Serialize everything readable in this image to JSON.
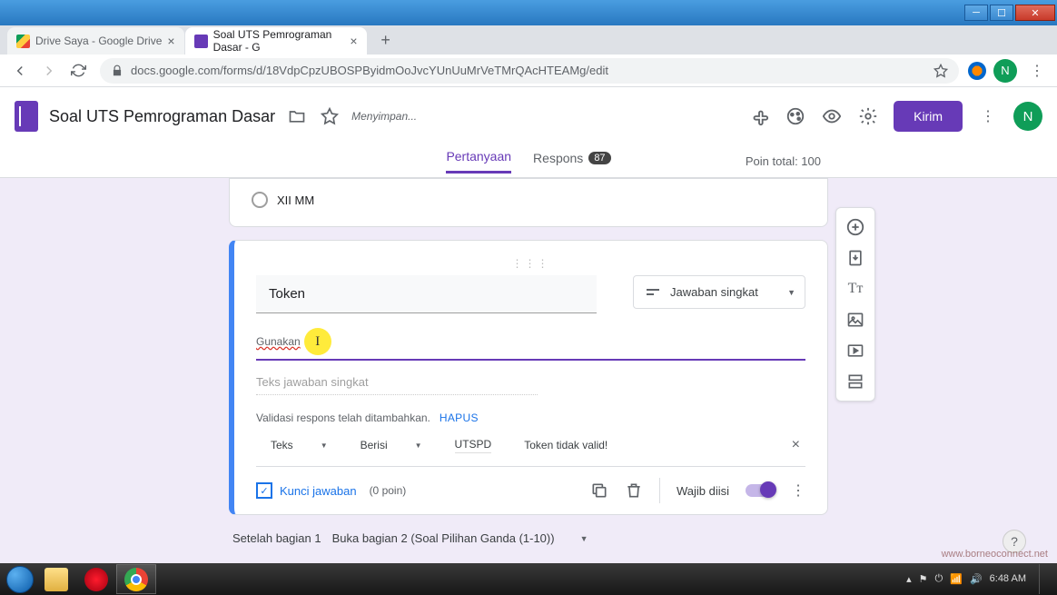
{
  "window": {
    "tabs": [
      {
        "title": "Drive Saya - Google Drive"
      },
      {
        "title": "Soal UTS Pemrograman Dasar - G"
      }
    ]
  },
  "browser": {
    "url": "docs.google.com/forms/d/18VdpCpzUBOSPByidmOoJvcYUnUuMrVeTMrQAcHTEAMg/edit",
    "avatar_letter": "N"
  },
  "header": {
    "doc_title": "Soal UTS Pemrograman Dasar",
    "saving": "Menyimpan...",
    "send": "Kirim",
    "avatar_letter": "N"
  },
  "tabs": {
    "questions": "Pertanyaan",
    "responses": "Respons",
    "response_count": "87",
    "points_total": "Poin total: 100"
  },
  "prev_card": {
    "option": "XII MM"
  },
  "question": {
    "title": "Token",
    "type_label": "Jawaban singkat",
    "description": "Gunakan",
    "answer_placeholder": "Teks jawaban singkat",
    "validation_msg": "Validasi respons telah ditambahkan.",
    "hapus": "HAPUS",
    "val_type": "Teks",
    "val_cond": "Berisi",
    "val_value": "UTSPD",
    "val_error": "Token tidak valid!",
    "answer_key": "Kunci jawaban",
    "points": "(0 poin)",
    "required": "Wajib diisi"
  },
  "after": {
    "label": "Setelah bagian 1",
    "value": "Buka bagian 2 (Soal Pilihan Ganda (1-10))"
  },
  "taskbar": {
    "time": "6:48 AM"
  },
  "watermark": "www.borneoconnect.net"
}
